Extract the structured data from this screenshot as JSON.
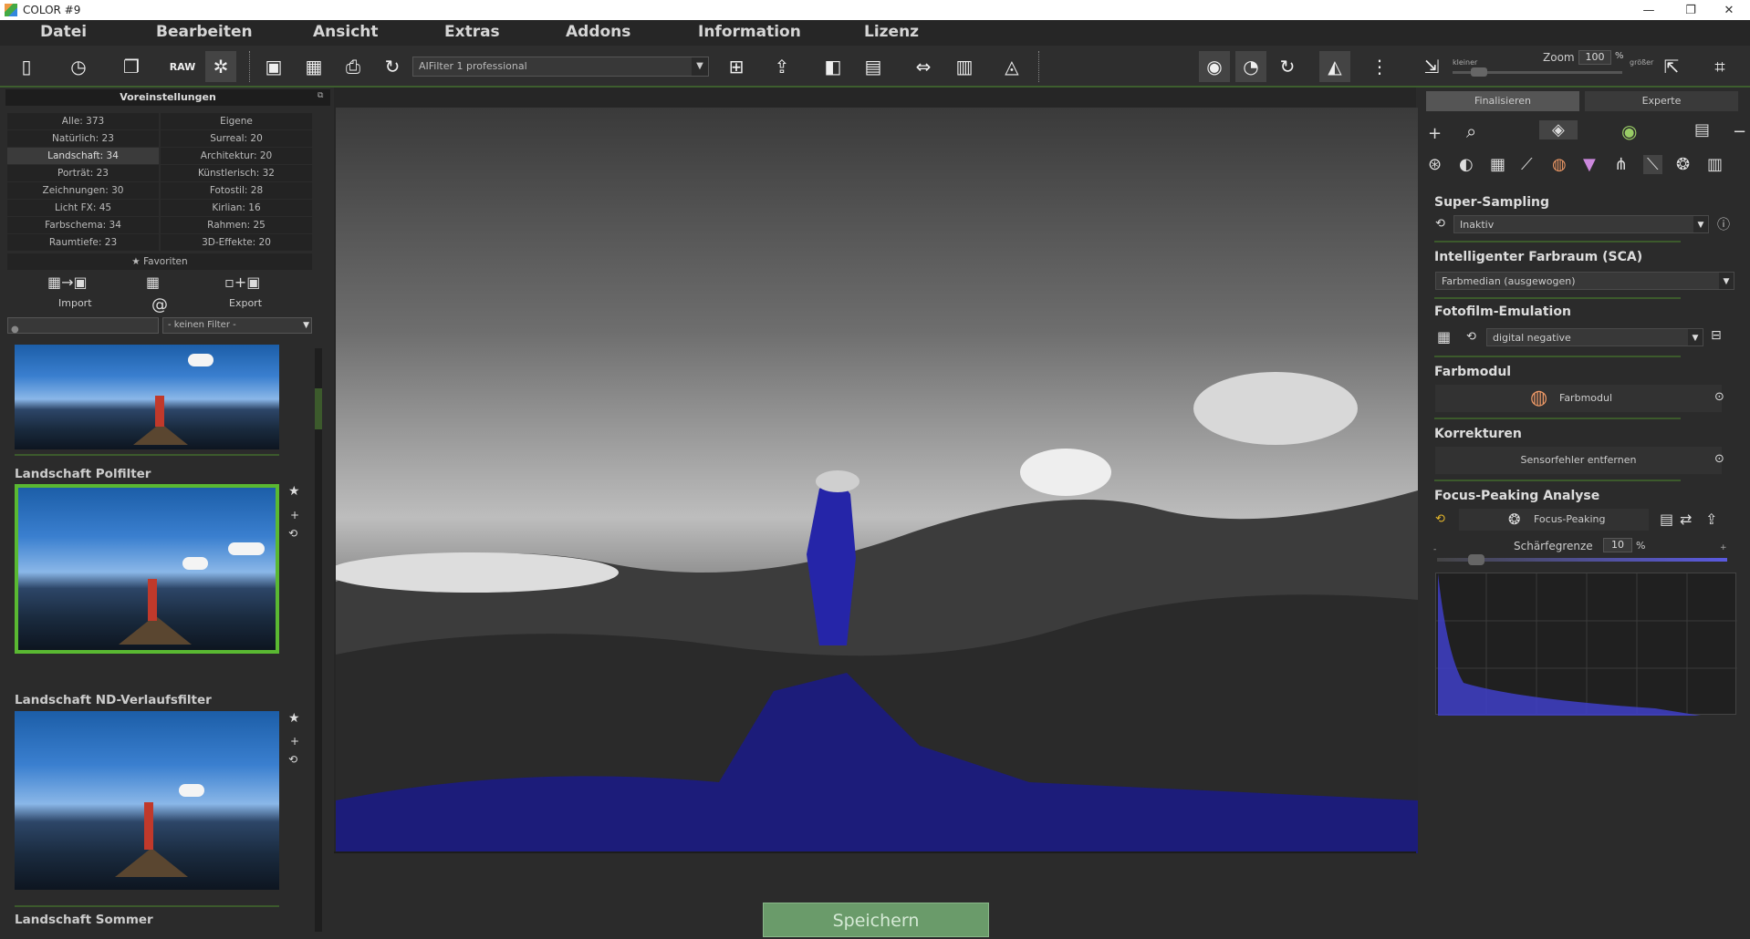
{
  "window": {
    "title": "COLOR #9",
    "controls": [
      "—",
      "❐",
      "✕"
    ]
  },
  "menu": [
    "Datei",
    "Bearbeiten",
    "Ansicht",
    "Extras",
    "Addons",
    "Information",
    "Lizenz"
  ],
  "toolbar": {
    "ai_filter": "AIFilter 1 professional",
    "zoom_label": "Zoom",
    "zoom_value": "100",
    "zoom_unit": "%",
    "zoom_smaller": "kleiner",
    "zoom_larger": "größer"
  },
  "left_panel": {
    "header": "Voreinstellungen",
    "categories": [
      [
        "Alle: 373",
        "Eigene"
      ],
      [
        "Natürlich: 23",
        "Surreal: 20"
      ],
      [
        "Landschaft: 34",
        "Architektur: 20"
      ],
      [
        "Porträt: 23",
        "Künstlerisch: 32"
      ],
      [
        "Zeichnungen: 30",
        "Fotostil: 28"
      ],
      [
        "Licht FX: 45",
        "Kirlian: 16"
      ],
      [
        "Farbschema: 34",
        "Rahmen: 25"
      ],
      [
        "Raumtiefe: 23",
        "3D-Effekte: 20"
      ]
    ],
    "favorites": "Favoriten",
    "import_label": "Import",
    "export_label": "Export",
    "filter_placeholder": "- keinen Filter -",
    "presets": [
      "Landschaft Polfilter",
      "Landschaft ND-Verlaufsfilter",
      "Landschaft Sommer"
    ]
  },
  "save_button": "Speichern",
  "right_panel": {
    "tabs": [
      "Finalisieren",
      "Experte"
    ],
    "super_sampling": {
      "title": "Super-Sampling",
      "value": "Inaktiv"
    },
    "sca": {
      "title": "Intelligenter Farbraum (SCA)",
      "value": "Farbmedian (ausgewogen)"
    },
    "film": {
      "title": "Fotofilm-Emulation",
      "value": "digital negative"
    },
    "color_module": {
      "title": "Farbmodul",
      "button": "Farbmodul"
    },
    "corrections": {
      "title": "Korrekturen",
      "button": "Sensorfehler entfernen"
    },
    "focus": {
      "title": "Focus-Peaking Analyse",
      "button": "Focus-Peaking",
      "threshold_label": "Schärfegrenze",
      "threshold_value": "10",
      "threshold_unit": "%",
      "minus": "-",
      "plus": "+"
    }
  },
  "colors": {
    "accent": "#3d5e2e",
    "selection": "#5ab832",
    "peaking": "#3333dd"
  }
}
